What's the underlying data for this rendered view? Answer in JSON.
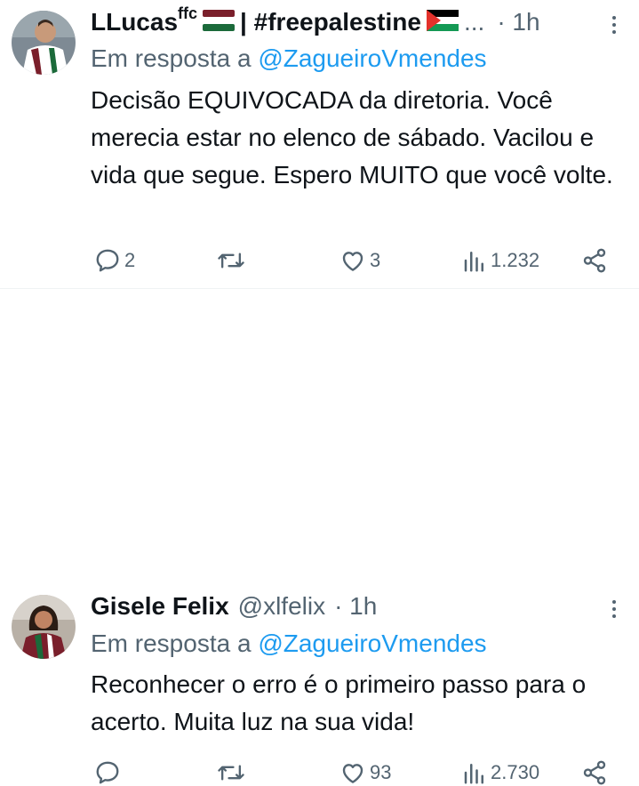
{
  "tweets": [
    {
      "name": "LLucas",
      "name_sup": "ffc",
      "name_suffix": "| #freepalestine",
      "ellipsis": "...",
      "time": "· 1h",
      "reply_prefix": "Em resposta a",
      "reply_to": "@ZagueiroVmendes",
      "text": "Decisão EQUIVOCADA da diretoria. Você merecia estar no elenco de sábado. Vacilou e vida que segue. Espero MUITO que você volte.",
      "replies": "2",
      "retweets": "",
      "likes": "3",
      "views": "1.232"
    },
    {
      "name": "Gisele Felix",
      "handle": "@xlfelix",
      "time": "· 1h",
      "reply_prefix": "Em resposta a",
      "reply_to": "@ZagueiroVmendes",
      "text": "Reconhecer o erro é o primeiro passo para o acerto. Muita luz na sua vida!",
      "replies": "",
      "retweets": "",
      "likes": "93",
      "views": "2.730"
    }
  ],
  "colors": {
    "text": "#0f1419",
    "secondary": "#536471",
    "link": "#1d9bf0",
    "divider": "#eff3f4"
  },
  "icons": [
    "reply-icon",
    "retweet-icon",
    "like-icon",
    "views-icon",
    "share-icon",
    "more-icon",
    "flag-icon"
  ]
}
